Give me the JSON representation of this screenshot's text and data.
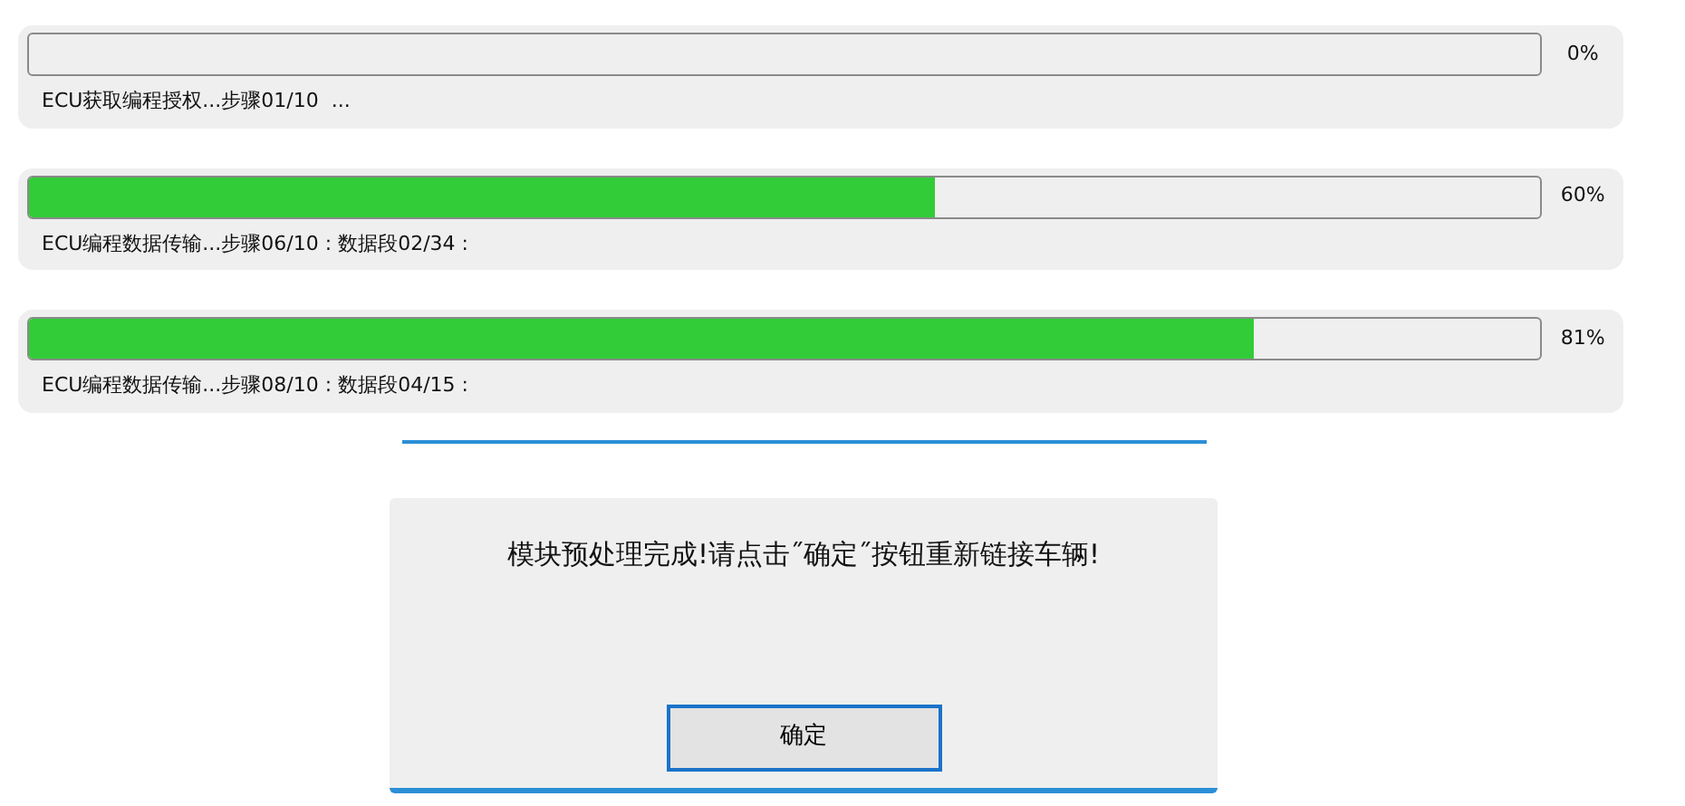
{
  "progress_panels": [
    {
      "level": 0,
      "percent": "0%",
      "status": "ECU获取编程授权...步骤01/10  ..."
    },
    {
      "level": 0.6,
      "percent": "60%",
      "status": "ECU编程数据传输...步骤06/10 : 数据段02/34 :"
    },
    {
      "level": 0.81,
      "percent": "81%",
      "status": "ECU编程数据传输...步骤08/10 : 数据段04/15 :"
    }
  ],
  "dialog": {
    "message": "模块预处理完成!请点击˝确定˝按钮重新链接车辆!",
    "buttons": [
      {
        "label": "确定",
        "focused": true
      }
    ]
  }
}
